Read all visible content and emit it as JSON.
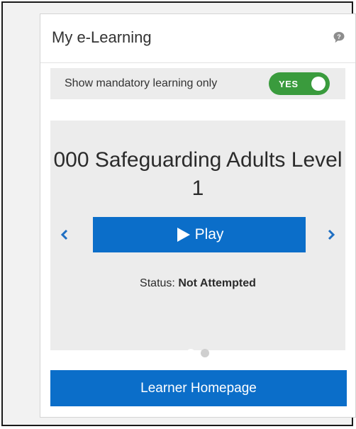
{
  "widget": {
    "title": "My e-Learning",
    "help_icon": "help-speech-bubble-icon"
  },
  "filter": {
    "label": "Show mandatory learning only",
    "toggle_text": "YES",
    "toggle_on": true,
    "toggle_color": "#3a9b3d"
  },
  "carousel": {
    "course_title": "000 Safeguarding Adults Level 1",
    "play_label": "Play",
    "play_icon": "play-triangle-icon",
    "status_label": "Status:",
    "status_value": "Not Attempted",
    "prev_icon": "chevron-left-icon",
    "next_icon": "chevron-right-icon",
    "pages": 2,
    "active_page": 1
  },
  "footer": {
    "home_label": "Learner Homepage"
  },
  "colors": {
    "primary": "#0b6ec9",
    "panel_bg": "#ececec",
    "text": "#333333"
  }
}
